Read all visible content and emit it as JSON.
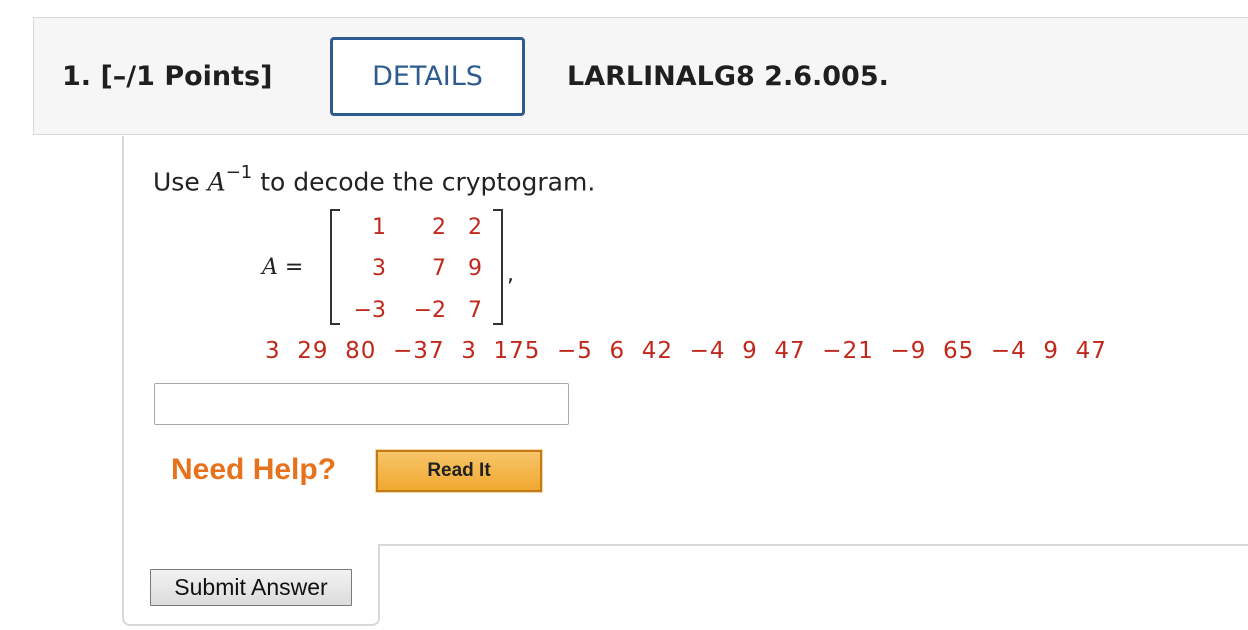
{
  "header": {
    "question_number": "1.",
    "points": "[–/1 Points]",
    "details_label": "DETAILS",
    "problem_id": "LARLINALG8 2.6.005."
  },
  "question": {
    "prompt_prefix": "Use ",
    "prompt_var": "A",
    "prompt_exp": "−1",
    "prompt_suffix": " to decode the cryptogram.",
    "matrix_name": "A",
    "matrix_eq": " =",
    "matrix": [
      [
        "1",
        "2",
        "2"
      ],
      [
        "3",
        "7",
        "9"
      ],
      [
        "−3",
        "−2",
        "7"
      ]
    ],
    "matrix_trailing": ",",
    "cryptogram": "3  29  80  −37  3  175  −5  6  42  −4  9  47  −21  −9  65  −4  9  47"
  },
  "answer": {
    "value": ""
  },
  "help": {
    "label": "Need Help?",
    "read_it": "Read It"
  },
  "submit": {
    "label": "Submit Answer"
  },
  "colors": {
    "accent": "#2f5c8f",
    "matrix_text": "#c0281c",
    "help_text": "#e8721c"
  }
}
